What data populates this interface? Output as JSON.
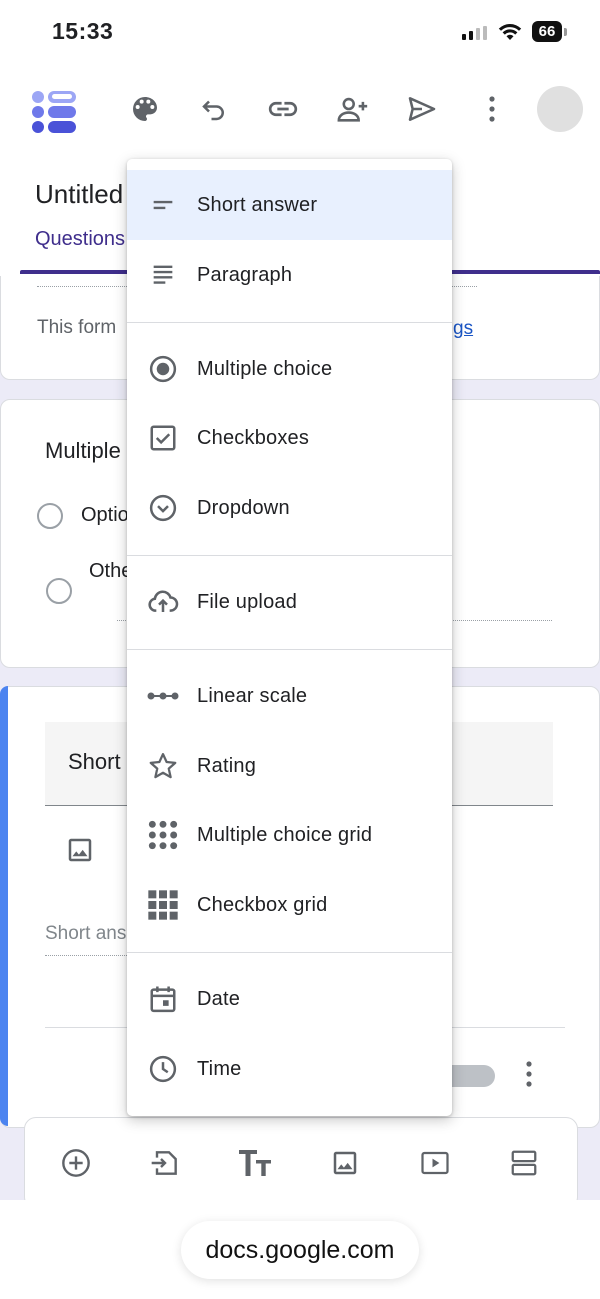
{
  "status_bar": {
    "time": "15:33",
    "battery": "66"
  },
  "toolbar": {
    "icons": [
      "forms-logo-icon",
      "palette-icon",
      "undo-icon",
      "link-icon",
      "add-person-icon",
      "send-icon",
      "more-vert-icon",
      "avatar"
    ]
  },
  "form": {
    "title": "Untitled",
    "tab_questions": "Questions",
    "notice_text": "This form",
    "settings_link": "gs",
    "question_title": "Multiple",
    "option_label": "Optio",
    "other_label": "Othe",
    "active_question_title": "Short",
    "short_answer_placeholder": "Short ans"
  },
  "menu": {
    "items": [
      {
        "label": "Short answer",
        "icon": "short-answer-icon",
        "selected": true
      },
      {
        "label": "Paragraph",
        "icon": "paragraph-icon"
      },
      {
        "label": "Multiple choice",
        "icon": "radio-button-icon"
      },
      {
        "label": "Checkboxes",
        "icon": "checkbox-icon"
      },
      {
        "label": "Dropdown",
        "icon": "dropdown-circle-icon"
      },
      {
        "label": "File upload",
        "icon": "cloud-upload-icon"
      },
      {
        "label": "Linear scale",
        "icon": "linear-scale-icon"
      },
      {
        "label": "Rating",
        "icon": "star-icon"
      },
      {
        "label": "Multiple choice grid",
        "icon": "dot-grid-icon"
      },
      {
        "label": "Checkbox grid",
        "icon": "square-grid-icon"
      },
      {
        "label": "Date",
        "icon": "calendar-icon"
      },
      {
        "label": "Time",
        "icon": "clock-icon"
      }
    ]
  },
  "bottom_toolbar": {
    "icons": [
      "add-question-icon",
      "import-questions-icon",
      "add-title-icon",
      "add-image-icon",
      "add-video-icon",
      "add-section-icon"
    ]
  },
  "browser": {
    "url": "docs.google.com"
  },
  "colors": {
    "accent": "#3f2e8c",
    "question_accent": "#4c84f0",
    "selected_item": "#e8f0fe",
    "form_bg": "#ecebf7"
  }
}
